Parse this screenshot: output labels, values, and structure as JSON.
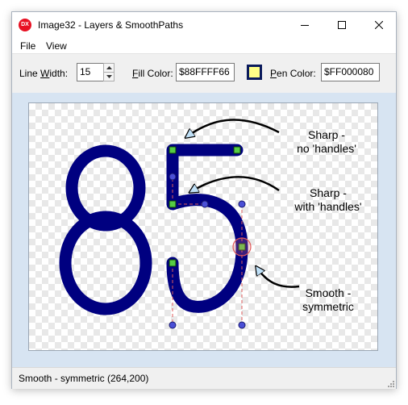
{
  "window": {
    "title": "Image32 - Layers & SmoothPaths",
    "app_icon_text": "DX"
  },
  "menu": {
    "items": [
      "File",
      "View"
    ]
  },
  "toolbar": {
    "line_width_label_pre": "Line ",
    "line_width_label_ul": "W",
    "line_width_label_post": "idth:",
    "line_width_value": "15",
    "fill_label_ul": "F",
    "fill_label_post": "ill Color:",
    "fill_value": "$88FFFF66",
    "fill_swatch_color": "#ffff88",
    "pen_label_ul": "P",
    "pen_label_post": "en Color:",
    "pen_value": "$FF000080"
  },
  "canvas": {
    "digits": "85",
    "digit_stroke_color": "#000080",
    "annotations": [
      {
        "line1": "Sharp -",
        "line2": "no 'handles'"
      },
      {
        "line1": "Sharp -",
        "line2": "with 'handles'"
      },
      {
        "line1": "Smooth -",
        "line2": "symmetric"
      }
    ]
  },
  "status": {
    "text": "Smooth - symmetric (264,200)"
  }
}
